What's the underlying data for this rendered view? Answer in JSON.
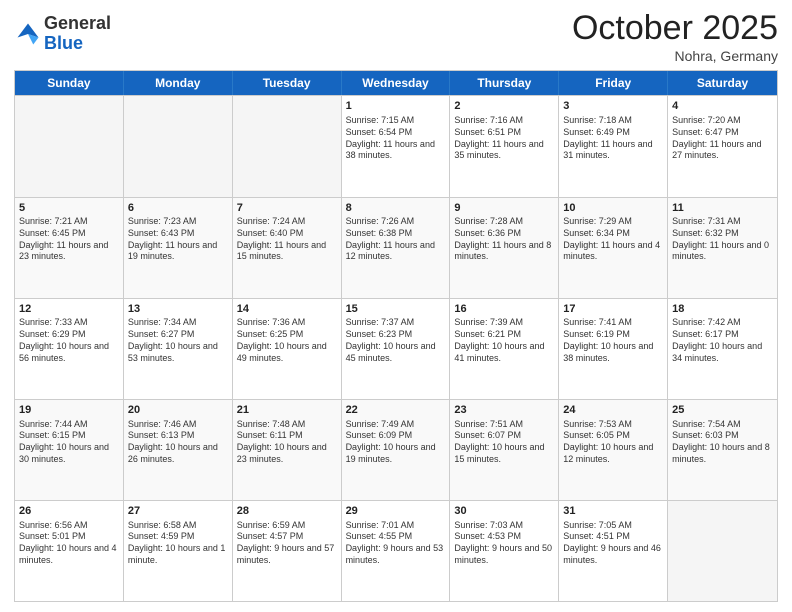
{
  "header": {
    "logo_general": "General",
    "logo_blue": "Blue",
    "month": "October 2025",
    "location": "Nohra, Germany"
  },
  "days_of_week": [
    "Sunday",
    "Monday",
    "Tuesday",
    "Wednesday",
    "Thursday",
    "Friday",
    "Saturday"
  ],
  "weeks": [
    [
      {
        "day": "",
        "empty": true
      },
      {
        "day": "",
        "empty": true
      },
      {
        "day": "",
        "empty": true
      },
      {
        "day": "1",
        "sunrise": "Sunrise: 7:15 AM",
        "sunset": "Sunset: 6:54 PM",
        "daylight": "Daylight: 11 hours and 38 minutes."
      },
      {
        "day": "2",
        "sunrise": "Sunrise: 7:16 AM",
        "sunset": "Sunset: 6:51 PM",
        "daylight": "Daylight: 11 hours and 35 minutes."
      },
      {
        "day": "3",
        "sunrise": "Sunrise: 7:18 AM",
        "sunset": "Sunset: 6:49 PM",
        "daylight": "Daylight: 11 hours and 31 minutes."
      },
      {
        "day": "4",
        "sunrise": "Sunrise: 7:20 AM",
        "sunset": "Sunset: 6:47 PM",
        "daylight": "Daylight: 11 hours and 27 minutes."
      }
    ],
    [
      {
        "day": "5",
        "sunrise": "Sunrise: 7:21 AM",
        "sunset": "Sunset: 6:45 PM",
        "daylight": "Daylight: 11 hours and 23 minutes."
      },
      {
        "day": "6",
        "sunrise": "Sunrise: 7:23 AM",
        "sunset": "Sunset: 6:43 PM",
        "daylight": "Daylight: 11 hours and 19 minutes."
      },
      {
        "day": "7",
        "sunrise": "Sunrise: 7:24 AM",
        "sunset": "Sunset: 6:40 PM",
        "daylight": "Daylight: 11 hours and 15 minutes."
      },
      {
        "day": "8",
        "sunrise": "Sunrise: 7:26 AM",
        "sunset": "Sunset: 6:38 PM",
        "daylight": "Daylight: 11 hours and 12 minutes."
      },
      {
        "day": "9",
        "sunrise": "Sunrise: 7:28 AM",
        "sunset": "Sunset: 6:36 PM",
        "daylight": "Daylight: 11 hours and 8 minutes."
      },
      {
        "day": "10",
        "sunrise": "Sunrise: 7:29 AM",
        "sunset": "Sunset: 6:34 PM",
        "daylight": "Daylight: 11 hours and 4 minutes."
      },
      {
        "day": "11",
        "sunrise": "Sunrise: 7:31 AM",
        "sunset": "Sunset: 6:32 PM",
        "daylight": "Daylight: 11 hours and 0 minutes."
      }
    ],
    [
      {
        "day": "12",
        "sunrise": "Sunrise: 7:33 AM",
        "sunset": "Sunset: 6:29 PM",
        "daylight": "Daylight: 10 hours and 56 minutes."
      },
      {
        "day": "13",
        "sunrise": "Sunrise: 7:34 AM",
        "sunset": "Sunset: 6:27 PM",
        "daylight": "Daylight: 10 hours and 53 minutes."
      },
      {
        "day": "14",
        "sunrise": "Sunrise: 7:36 AM",
        "sunset": "Sunset: 6:25 PM",
        "daylight": "Daylight: 10 hours and 49 minutes."
      },
      {
        "day": "15",
        "sunrise": "Sunrise: 7:37 AM",
        "sunset": "Sunset: 6:23 PM",
        "daylight": "Daylight: 10 hours and 45 minutes."
      },
      {
        "day": "16",
        "sunrise": "Sunrise: 7:39 AM",
        "sunset": "Sunset: 6:21 PM",
        "daylight": "Daylight: 10 hours and 41 minutes."
      },
      {
        "day": "17",
        "sunrise": "Sunrise: 7:41 AM",
        "sunset": "Sunset: 6:19 PM",
        "daylight": "Daylight: 10 hours and 38 minutes."
      },
      {
        "day": "18",
        "sunrise": "Sunrise: 7:42 AM",
        "sunset": "Sunset: 6:17 PM",
        "daylight": "Daylight: 10 hours and 34 minutes."
      }
    ],
    [
      {
        "day": "19",
        "sunrise": "Sunrise: 7:44 AM",
        "sunset": "Sunset: 6:15 PM",
        "daylight": "Daylight: 10 hours and 30 minutes."
      },
      {
        "day": "20",
        "sunrise": "Sunrise: 7:46 AM",
        "sunset": "Sunset: 6:13 PM",
        "daylight": "Daylight: 10 hours and 26 minutes."
      },
      {
        "day": "21",
        "sunrise": "Sunrise: 7:48 AM",
        "sunset": "Sunset: 6:11 PM",
        "daylight": "Daylight: 10 hours and 23 minutes."
      },
      {
        "day": "22",
        "sunrise": "Sunrise: 7:49 AM",
        "sunset": "Sunset: 6:09 PM",
        "daylight": "Daylight: 10 hours and 19 minutes."
      },
      {
        "day": "23",
        "sunrise": "Sunrise: 7:51 AM",
        "sunset": "Sunset: 6:07 PM",
        "daylight": "Daylight: 10 hours and 15 minutes."
      },
      {
        "day": "24",
        "sunrise": "Sunrise: 7:53 AM",
        "sunset": "Sunset: 6:05 PM",
        "daylight": "Daylight: 10 hours and 12 minutes."
      },
      {
        "day": "25",
        "sunrise": "Sunrise: 7:54 AM",
        "sunset": "Sunset: 6:03 PM",
        "daylight": "Daylight: 10 hours and 8 minutes."
      }
    ],
    [
      {
        "day": "26",
        "sunrise": "Sunrise: 6:56 AM",
        "sunset": "Sunset: 5:01 PM",
        "daylight": "Daylight: 10 hours and 4 minutes."
      },
      {
        "day": "27",
        "sunrise": "Sunrise: 6:58 AM",
        "sunset": "Sunset: 4:59 PM",
        "daylight": "Daylight: 10 hours and 1 minute."
      },
      {
        "day": "28",
        "sunrise": "Sunrise: 6:59 AM",
        "sunset": "Sunset: 4:57 PM",
        "daylight": "Daylight: 9 hours and 57 minutes."
      },
      {
        "day": "29",
        "sunrise": "Sunrise: 7:01 AM",
        "sunset": "Sunset: 4:55 PM",
        "daylight": "Daylight: 9 hours and 53 minutes."
      },
      {
        "day": "30",
        "sunrise": "Sunrise: 7:03 AM",
        "sunset": "Sunset: 4:53 PM",
        "daylight": "Daylight: 9 hours and 50 minutes."
      },
      {
        "day": "31",
        "sunrise": "Sunrise: 7:05 AM",
        "sunset": "Sunset: 4:51 PM",
        "daylight": "Daylight: 9 hours and 46 minutes."
      },
      {
        "day": "",
        "empty": true
      }
    ]
  ]
}
